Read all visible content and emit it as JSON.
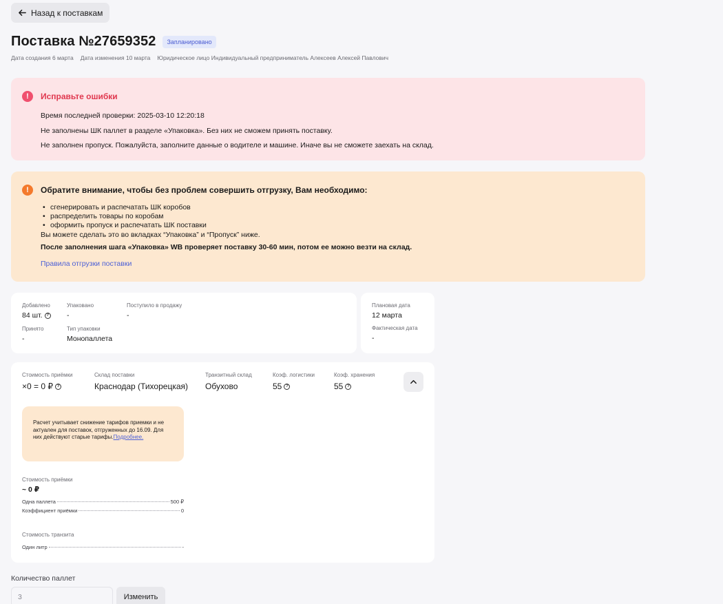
{
  "back_button": {
    "label": "Назад к поставкам",
    "icon": "arrow-left-icon"
  },
  "header": {
    "title": "Поставка №27659352",
    "status": "Запланировано",
    "status_color": "#4a5bd1",
    "meta": [
      "Дата создания 6 марта",
      "Дата изменения 10 марта",
      "Юридическое лицо Индивидуальный предприниматель Алексеев Алексей Павлович"
    ]
  },
  "error_alert": {
    "title": "Исправьте ошибки",
    "lines": [
      "Время последней проверки: 2025-03-10 12:20:18",
      "Не заполнены ШК паллет в разделе «Упаковка». Без них не сможем принять поставку.",
      "Не заполнен пропуск. Пожалуйста, заполните данные о водителе и машине. Иначе вы не сможете заехать на склад."
    ],
    "color": "#e0384f"
  },
  "warning_alert": {
    "title": "Обратите внимание, чтобы без проблем совершить отгрузку, Вам необходимо:",
    "items": [
      "сгенерировать и распечатать ШК коробов",
      "распределить товары по коробам",
      "оформить пропуск и распечатать ШК поставки"
    ],
    "note": "Вы можете сделать это во вкладках “Упаковка” и “Пропуск” ниже.",
    "bold_note": "После заполнения шага «Упаковка» WB проверяет поставку 30-60 мин, потом ее можно везти на склад.",
    "link": "Правила отгрузки поставки",
    "color": "#f47a2c"
  },
  "info": {
    "added": {
      "label": "Добавлено",
      "value": "84 шт."
    },
    "packed": {
      "label": "Упаковано",
      "value": "-"
    },
    "on_sale": {
      "label": "Поступило в продажу",
      "value": "-"
    },
    "accepted": {
      "label": "Принято",
      "value": "-"
    },
    "pack_type": {
      "label": "Тип упаковки",
      "value": "Монопаллета"
    }
  },
  "dates": {
    "planned": {
      "label": "Плановая дата",
      "value": "12 марта"
    },
    "actual": {
      "label": "Фактическая дата",
      "value": "-"
    }
  },
  "cost": {
    "acceptance": {
      "label": "Стоимость приёмки",
      "value": "×0 = 0 ₽"
    },
    "warehouse": {
      "label": "Склад поставки",
      "value": "Краснодар (Тихорецкая)"
    },
    "transit": {
      "label": "Транзитный склад",
      "value": "Обухово"
    },
    "logistics": {
      "label": "Коэф. логистики",
      "value": "55"
    },
    "storage": {
      "label": "Коэф. хранения",
      "value": "55"
    },
    "note_text": "Расчет учитывает снижение тарифов приемки и не актуален для поставок, отгруженных до 16.09. Для них действуют старые тарифы.",
    "note_link": "Подробнее.",
    "acceptance_detail": {
      "label": "Стоимость приёмки",
      "value": "~ 0 ₽",
      "rows": [
        {
          "name": "Одна паллета",
          "value": "500 ₽"
        },
        {
          "name": "Коэффициент приёмки",
          "value": "0"
        }
      ]
    },
    "transit_detail": {
      "label": "Стоимость транзита",
      "rows": [
        {
          "name": "Один литр",
          "value": "-"
        }
      ]
    }
  },
  "pallets": {
    "label": "Количество паллет",
    "value": "3",
    "button": "Изменить"
  }
}
